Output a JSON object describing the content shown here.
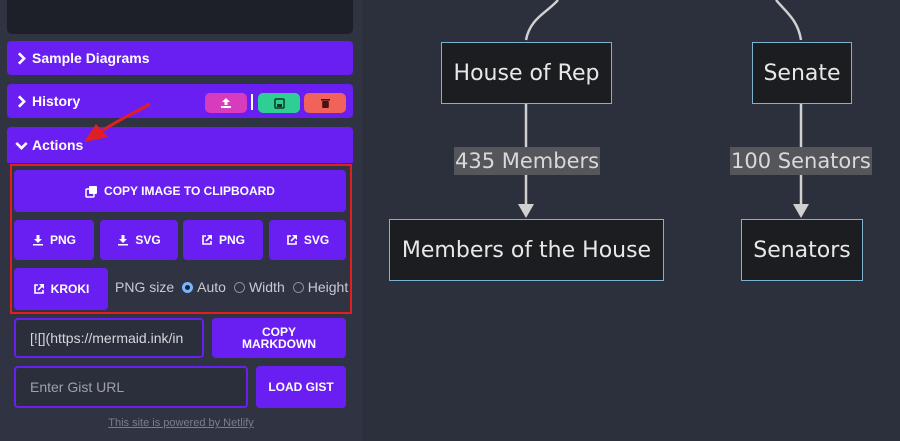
{
  "sidebar": {
    "sections": {
      "samples": "Sample Diagrams",
      "history": "History",
      "actions": "Actions"
    },
    "actions": {
      "copy_image": "COPY IMAGE TO CLIPBOARD",
      "png_download": "PNG",
      "svg_download": "SVG",
      "png_open": "PNG",
      "svg_open": "SVG",
      "kroki": "KROKI",
      "png_size_label": "PNG size",
      "size_options": [
        "Auto",
        "Width",
        "Height"
      ],
      "size_selected": "Auto"
    },
    "markdown": {
      "value": "[![](https://mermaid.ink/in",
      "copy_line1": "COPY",
      "copy_line2": "MARKDOWN"
    },
    "gist": {
      "placeholder": "Enter Gist URL",
      "load": "LOAD GIST"
    },
    "footer": "This site is powered by Netlify"
  },
  "diagram": {
    "nodes": {
      "house": "House of Rep",
      "senate": "Senate",
      "members": "Members of the House",
      "senators": "Senators"
    },
    "edges": {
      "house_members": "435 Members",
      "senate_senators": "100 Senators"
    }
  },
  "colors": {
    "accent": "#6a1ff2",
    "upload": "#d93bbd",
    "save": "#2fcf93",
    "delete": "#f1625b",
    "highlight": "#e21f1f",
    "arrow": "#e02020"
  }
}
